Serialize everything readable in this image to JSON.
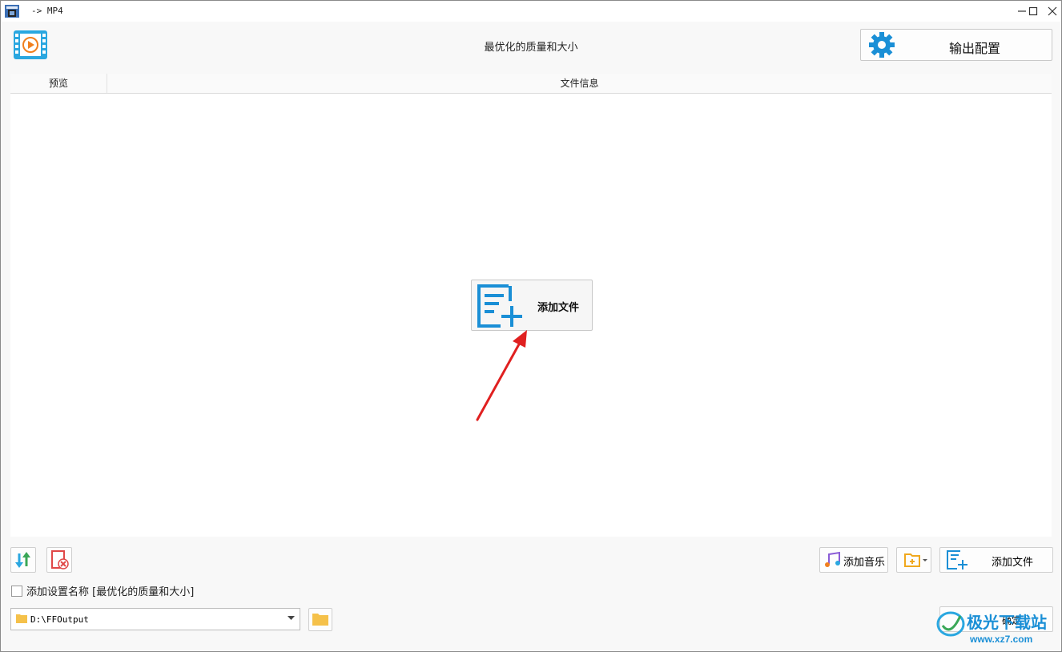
{
  "window": {
    "title": "-> MP4"
  },
  "header": {
    "title": "最优化的质量和大小",
    "output_button_label": "输出配置"
  },
  "table": {
    "columns": [
      "预览",
      "文件信息"
    ]
  },
  "center_add_button_label": "添加文件",
  "toolbar": {
    "add_music_label": "添加音乐",
    "add_file_label": "添加文件"
  },
  "options": {
    "add_setting_name_label": "添加设置名称 [最优化的质量和大小]",
    "add_setting_name_checked": false
  },
  "output_path": {
    "value": "D:\\FFOutput"
  },
  "ok_button_label": "确定",
  "watermark": {
    "brand": "极光下载站",
    "url": "www.xz7.com"
  },
  "colors": {
    "accent_blue": "#1a8fd6",
    "annotation_arrow": "#e02020",
    "delete_red": "#e04848"
  }
}
